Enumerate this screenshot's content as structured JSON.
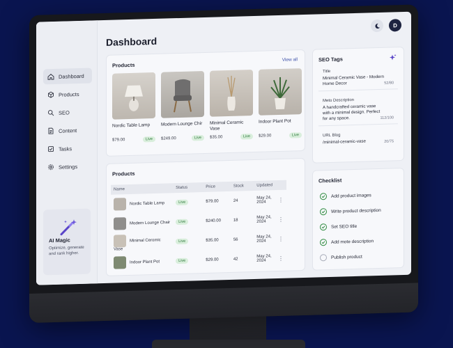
{
  "sidebar": {
    "items": [
      {
        "label": "Dashboard",
        "icon": "home-icon"
      },
      {
        "label": "Products",
        "icon": "box-icon"
      },
      {
        "label": "SEO",
        "icon": "search-icon"
      },
      {
        "label": "Content",
        "icon": "document-icon"
      },
      {
        "label": "Tasks",
        "icon": "checkbox-icon"
      },
      {
        "label": "Settings",
        "icon": "gear-icon"
      }
    ],
    "ai_card": {
      "title": "AI Magic",
      "subtitle": "Optimize, generate and rank higher.",
      "icon": "magic-wand-icon"
    }
  },
  "header": {
    "title": "Dashboard",
    "avatar_initial": "D",
    "theme_icon": "moon-icon"
  },
  "products_card": {
    "title": "Products",
    "view_all": "View all",
    "items": [
      {
        "name": "Nordic Table Lamp",
        "price": "$79.00",
        "status": "Live"
      },
      {
        "name": "Modern Lounge Chir",
        "price": "$249.00",
        "status": "Live"
      },
      {
        "name": "Minimal Ceramic Vase",
        "price": "$35.00",
        "status": "Live"
      },
      {
        "name": "Indoor Plant Pot",
        "price": "$29.00",
        "status": "Live"
      }
    ]
  },
  "products_table": {
    "title": "Products",
    "columns": [
      "Name",
      "Status",
      "Price",
      "Stock",
      "Updated"
    ],
    "rows": [
      {
        "name": "Nordic Table Lamp",
        "status": "Live",
        "price": "$79.00",
        "stock": "24",
        "updated": "May 24, 2024"
      },
      {
        "name": "Modern Lounge Chair",
        "status": "Live",
        "price": "$240.00",
        "stock": "18",
        "updated": "May 24, 2024"
      },
      {
        "name": "Minimal Ceromic Vase",
        "status": "Live",
        "price": "$35.00",
        "stock": "56",
        "updated": "May 24, 2024"
      },
      {
        "name": "Indoor Plant Pot",
        "status": "Live",
        "price": "$29.00",
        "stock": "42",
        "updated": "May 24, 2024"
      }
    ]
  },
  "seo_tags": {
    "title": "SEO Tags",
    "fields": [
      {
        "label": "Title",
        "value": "Minimal Ceramic Vase - Modern Home Decor",
        "count": "52/80"
      },
      {
        "label": "Meto Description",
        "value": "A handcrafted ceramic vase with a minimal design. Perfect for any space.",
        "count": "112/100"
      },
      {
        "label": "URL Blog",
        "value": "/minimal-ceramic-vase",
        "count": "20/75"
      }
    ]
  },
  "checklist": {
    "title": "Checklist",
    "items": [
      {
        "label": "Add product images",
        "done": true
      },
      {
        "label": "Write product description",
        "done": true
      },
      {
        "label": "Set SEO title",
        "done": true
      },
      {
        "label": "Add mote description",
        "done": true
      },
      {
        "label": "Publish product",
        "done": false
      }
    ]
  },
  "colors": {
    "accent": "#2d7a3b",
    "brand": "#1d2340",
    "background": "#0a1550"
  }
}
